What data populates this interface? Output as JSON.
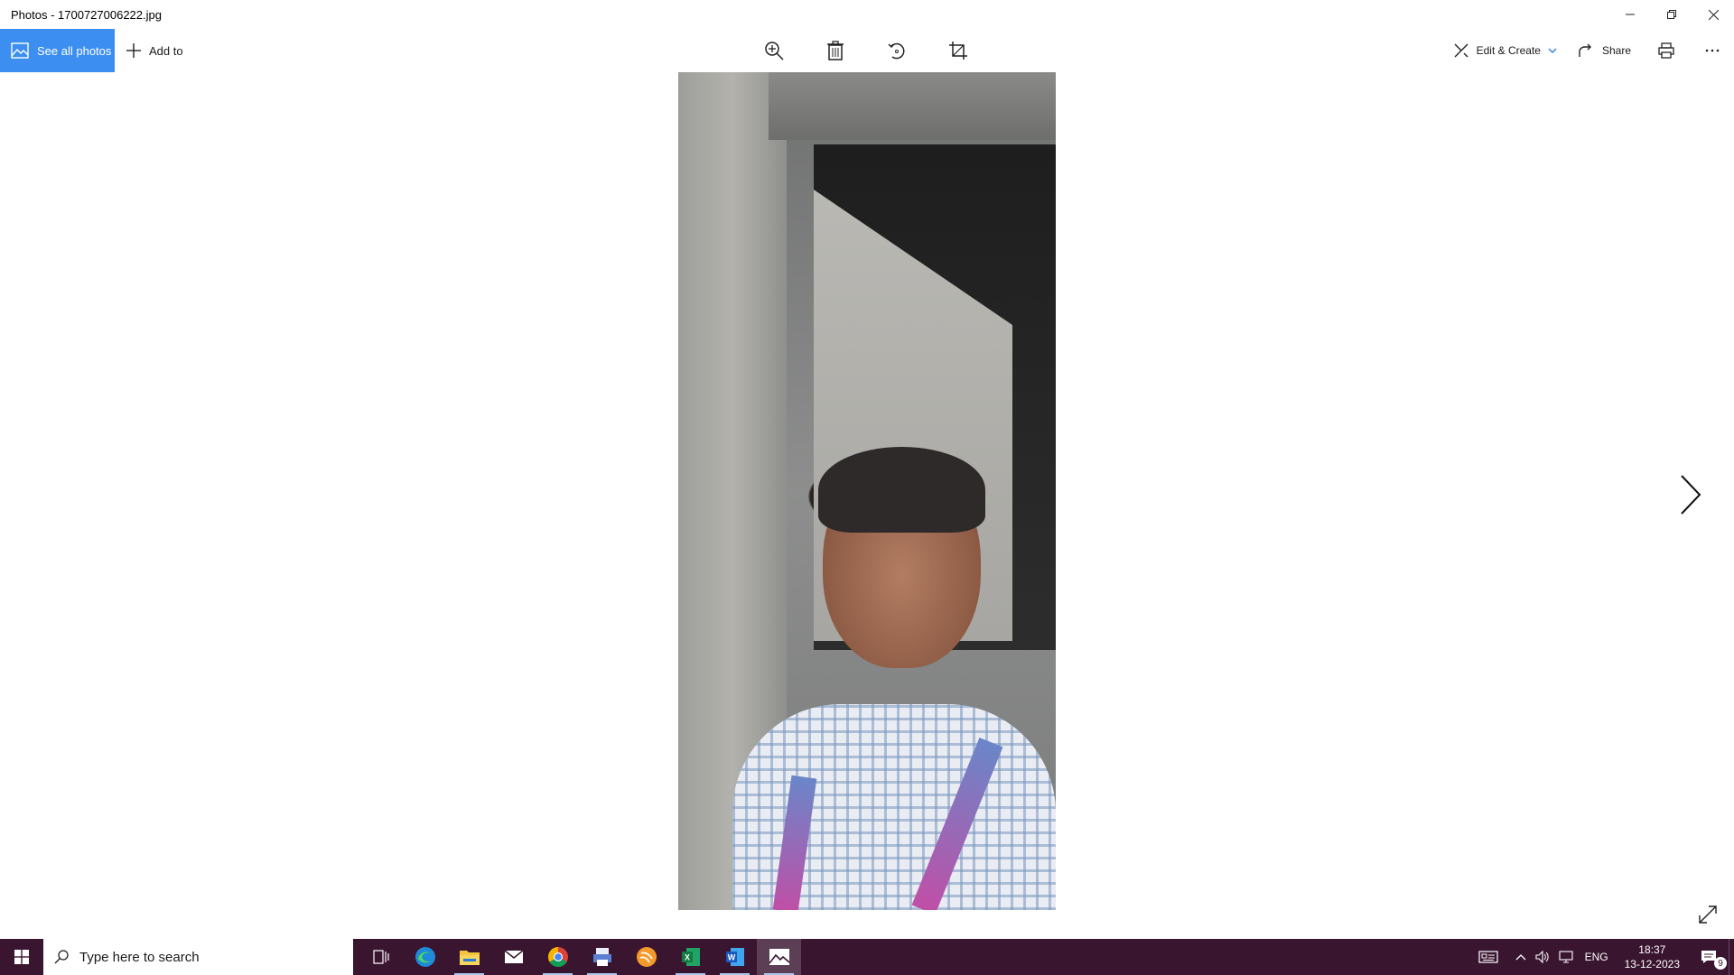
{
  "window": {
    "title": "Photos - 1700727006222.jpg",
    "controls": [
      "minimize-icon",
      "restore-icon",
      "close-icon"
    ]
  },
  "toolbar": {
    "see_all_label": "See all photos",
    "add_to_label": "Add to",
    "center_tools": [
      "zoom-in-icon",
      "delete-icon",
      "rotate-icon",
      "crop-icon"
    ],
    "edit_create_label": "Edit & Create",
    "share_label": "Share",
    "print_icon": "print-icon",
    "more_icon": "more-icon"
  },
  "viewer": {
    "next_icon": "chevron-right-icon",
    "expand_icon": "expand-icon"
  },
  "colors": {
    "accent": "#3c8ff0",
    "taskbar": "#3a1530"
  },
  "taskbar": {
    "search_placeholder": "Type here to search",
    "apps": [
      "task-view",
      "edge",
      "file-explorer",
      "mail",
      "chrome",
      "app-printer",
      "app-orange",
      "excel",
      "word",
      "photos"
    ],
    "tray": {
      "language": "ENG",
      "time": "18:37",
      "date": "13-12-2023",
      "notification_count": "9"
    }
  }
}
